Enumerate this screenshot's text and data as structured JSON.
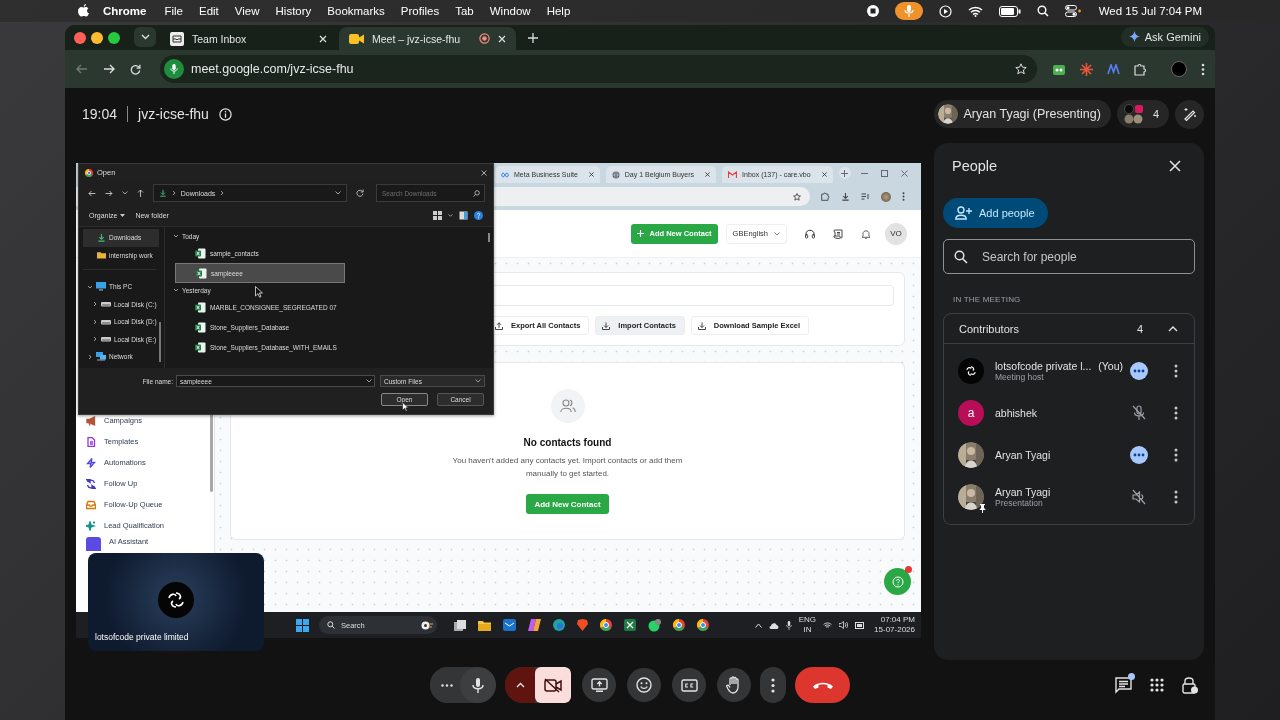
{
  "menu_bar": {
    "app": "Chrome",
    "menus": [
      "File",
      "Edit",
      "View",
      "History",
      "Bookmarks",
      "Profiles",
      "Tab",
      "Window",
      "Help"
    ],
    "clock": "Wed 15 Jul  7:04 PM"
  },
  "browser": {
    "tabs": [
      {
        "title": "Team Inbox",
        "selected": false,
        "recording": false
      },
      {
        "title": "Meet – jvz-icse-fhu",
        "selected": true,
        "recording": true
      }
    ],
    "gemini": "Ask Gemini",
    "url": "meet.google.com/jvz-icse-fhu"
  },
  "meeting": {
    "time": "19:04",
    "code": "jvz-icse-fhu",
    "presenter": "Aryan Tyagi (Presenting)",
    "participant_count": "4"
  },
  "shared_screen": {
    "browser_tabs": [
      {
        "title": "Meta Business Suite"
      },
      {
        "title": "Day 1 Belgium Buyers"
      },
      {
        "title": "Inbox (137) - care.vbo"
      }
    ],
    "header": {
      "add_button": "Add New Contact",
      "language": "GBEnglish",
      "avatar": "VO"
    },
    "sidebar": [
      {
        "label": "Campaigns",
        "color": "#b4533a"
      },
      {
        "label": "Templates",
        "color": "#9333ea"
      },
      {
        "label": "Automations",
        "color": "#4f46e5"
      },
      {
        "label": "Follow Up",
        "color": "#4338ca"
      },
      {
        "label": "Follow-Up Queue",
        "color": "#d97706"
      },
      {
        "label": "Lead Qualification",
        "color": "#0d9488"
      },
      {
        "label": "AI Assistant",
        "color": "#5b4be0"
      }
    ],
    "actions": [
      {
        "label": "Export All Contacts",
        "highlighted": false
      },
      {
        "label": "Import Contacts",
        "highlighted": true
      },
      {
        "label": "Download Sample Excel",
        "highlighted": false
      }
    ],
    "empty_state": {
      "title": "No contacts found",
      "text": "You haven't added any contacts yet. Import contacts or add them manually to get started.",
      "button": "Add New Contact"
    },
    "dialog": {
      "title": "Open",
      "path": "Downloads",
      "search_placeholder": "Search Downloads",
      "organize": "Organize",
      "new_folder": "New folder",
      "quick_access": [
        {
          "label": "Downloads",
          "kind": "download",
          "selected": true
        },
        {
          "label": "internship work",
          "kind": "folder",
          "selected": false
        }
      ],
      "tree": [
        {
          "label": "This PC",
          "kind": "pc",
          "expanded": true,
          "children": [
            {
              "label": "Local Disk (C:)",
              "kind": "drive",
              "expanded": false
            },
            {
              "label": "Local Disk (D:)",
              "kind": "drive",
              "expanded": false
            },
            {
              "label": "Local Disk (E:)",
              "kind": "drive",
              "expanded": false
            }
          ]
        },
        {
          "label": "Network",
          "kind": "network",
          "expanded": false
        }
      ],
      "groups": [
        {
          "label": "Today",
          "expanded": true,
          "files": [
            {
              "name": "sample_contacts",
              "selected": false
            },
            {
              "name": "sampleeee",
              "selected": true
            }
          ]
        },
        {
          "label": "Yesterday",
          "expanded": true,
          "files": [
            {
              "name": "MARBLE_CONSIGNEE_SEGREGATED 07",
              "selected": false
            },
            {
              "name": "Stone_Suppliers_Database",
              "selected": false
            },
            {
              "name": "Stone_Suppliers_Database_WITH_EMAILS",
              "selected": false
            }
          ]
        }
      ],
      "file_name_label": "File name:",
      "file_name": "sampleeee",
      "file_type": "Custom Files",
      "open_button": "Open",
      "cancel_button": "Cancel"
    },
    "taskbar": {
      "search": "Search",
      "language": "ENG",
      "region": "IN",
      "time": "07:04 PM",
      "date": "15-07-2026"
    }
  },
  "self_view": {
    "name": "lotsofcode private limited"
  },
  "people": {
    "title": "People",
    "add_button": "Add people",
    "search_placeholder": "Search for people",
    "section": "IN THE MEETING",
    "group": {
      "title": "Contributors",
      "count": "4",
      "expanded": true
    },
    "members": [
      {
        "kind": "logo",
        "name": "lotsofcode private l...",
        "you": "(You)",
        "subtitle": "Meeting host",
        "speaking": true,
        "muted": false
      },
      {
        "kind": "letter",
        "name": "abhishek",
        "initial": "a",
        "color": "#b80d57",
        "speaking": false,
        "muted": true
      },
      {
        "kind": "person",
        "name": "Aryan Tyagi",
        "speaking": true,
        "muted": false
      },
      {
        "kind": "presentation",
        "name": "Aryan Tyagi",
        "subtitle": "Presentation",
        "speaking": false,
        "muted": true
      }
    ]
  },
  "controls": {
    "mic_on": true,
    "camera_on": false,
    "chat_unread": true
  }
}
